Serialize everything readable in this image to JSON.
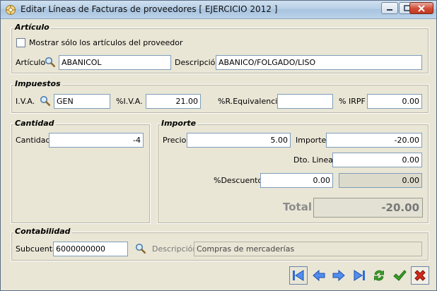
{
  "window": {
    "title": "Editar Líneas de Facturas de proveedores [ EJERCICIO 2012 ]"
  },
  "articulo": {
    "section_title": "Artículo",
    "checkbox_label": "Mostrar sólo los artículos del proveedor",
    "checkbox_checked": false,
    "articulo_label": "Artículo",
    "articulo_value": "ABANICOL",
    "descripcion_label": "Descripción",
    "descripcion_value": "ABANICO/FOLGADO/LISO"
  },
  "impuestos": {
    "section_title": "Impuestos",
    "iva_label": "I.V.A.",
    "iva_value": "GEN",
    "piva_label": "%I.V.A.",
    "piva_value": "21.00",
    "req_label": "%R.Equivalencia",
    "req_value": "",
    "irpf_label": "% IRPF",
    "irpf_value": "0.00"
  },
  "cantidad": {
    "section_title": "Cantidad",
    "cantidad_label": "Cantidad",
    "cantidad_value": "-4"
  },
  "importe": {
    "section_title": "Importe",
    "precio_label": "Precio",
    "precio_value": "5.00",
    "importe_label": "Importe",
    "importe_value": "-20.00",
    "dto_label": "Dto. Lineal",
    "dto_value": "0.00",
    "descuento_label": "%Descuento",
    "descuento_value": "0.00",
    "descuento_amount": "0.00",
    "total_label": "Total",
    "total_value": "-20.00"
  },
  "contabilidad": {
    "section_title": "Contabilidad",
    "subcuenta_label": "Subcuenta",
    "subcuenta_value": "6000000000",
    "descripcion_label": "Descripción",
    "descripcion_value": "Compras de mercaderías"
  },
  "toolbar": {
    "icons": [
      "first-icon",
      "previous-icon",
      "next-icon",
      "last-icon",
      "refresh-icon",
      "accept-icon",
      "cancel-icon"
    ]
  },
  "colors": {
    "accent_blue": "#2d6bd6",
    "accept_green": "#3aa02a",
    "cancel_red": "#d52a1c"
  }
}
